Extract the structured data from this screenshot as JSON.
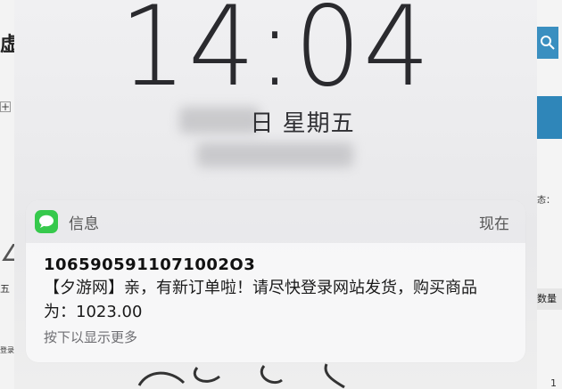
{
  "background_page": {
    "left_title_fragment": "虚",
    "left_plus_icon": "+",
    "left_number_fragment": "五",
    "left_login_fragment": "登录",
    "right_status_label": "态：",
    "right_qty_header": "数量",
    "right_row_number": "1"
  },
  "lockscreen": {
    "time": "14:04",
    "date_visible": "日 星期五"
  },
  "notification": {
    "app_name": "信息",
    "time_label": "现在",
    "sender": "1065905911071002O3",
    "message": "【夕游网】亲，有新订单啦！请尽快登录网站发货，购买商品为：1023.00",
    "more_hint": "按下以显示更多",
    "icon": "messages-icon",
    "icon_color": "#36c94c"
  }
}
